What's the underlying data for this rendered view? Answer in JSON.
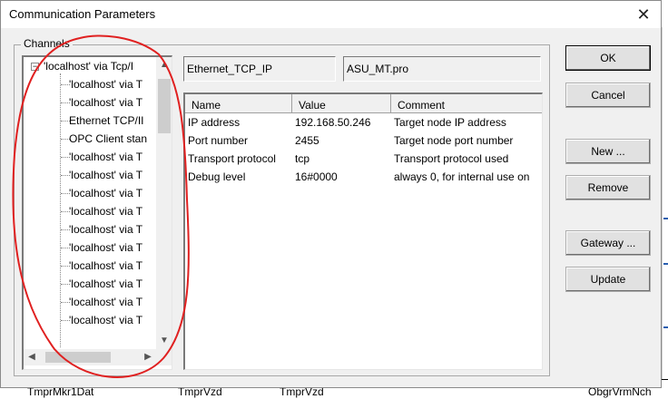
{
  "dialog": {
    "title": "Communication Parameters",
    "close_glyph": "✕"
  },
  "channels": {
    "group_label": "Channels",
    "items": [
      {
        "label": "'localhost' via Tcp/I"
      },
      {
        "label": "'localhost' via T"
      },
      {
        "label": "'localhost' via T"
      },
      {
        "label": "Ethernet TCP/II"
      },
      {
        "label": "OPC Client stan"
      },
      {
        "label": "'localhost' via T"
      },
      {
        "label": "'localhost' via T"
      },
      {
        "label": "'localhost' via T"
      },
      {
        "label": "'localhost' via T"
      },
      {
        "label": "'localhost' via T"
      },
      {
        "label": "'localhost' via T"
      },
      {
        "label": "'localhost' via T"
      },
      {
        "label": "'localhost' via T"
      },
      {
        "label": "'localhost' via T"
      },
      {
        "label": "'localhost' via T"
      }
    ],
    "expander_glyph": "−"
  },
  "driver_name": "Ethernet_TCP_IP",
  "project_file": "ASU_MT.pro",
  "params_table": {
    "headers": [
      "Name",
      "Value",
      "Comment"
    ],
    "rows": [
      {
        "name": "IP address",
        "value": "192.168.50.246",
        "comment": "Target node IP address"
      },
      {
        "name": "Port number",
        "value": "2455",
        "comment": "Target node port number"
      },
      {
        "name": "Transport protocol",
        "value": "tcp",
        "comment": "Transport protocol used"
      },
      {
        "name": "Debug level",
        "value": "16#0000",
        "comment": "always 0, for internal use on"
      }
    ]
  },
  "buttons": {
    "ok": "OK",
    "cancel": "Cancel",
    "new": "New ...",
    "remove": "Remove",
    "gateway": "Gateway ...",
    "update": "Update"
  },
  "background_labels": {
    "bottom": [
      "TmprMkr1Dat",
      "TmprVzd",
      "TmprVzd",
      "ObgrVrmNch"
    ]
  },
  "colors": {
    "annotation": "#e02020",
    "dialog_bg": "#f0f0f0"
  }
}
